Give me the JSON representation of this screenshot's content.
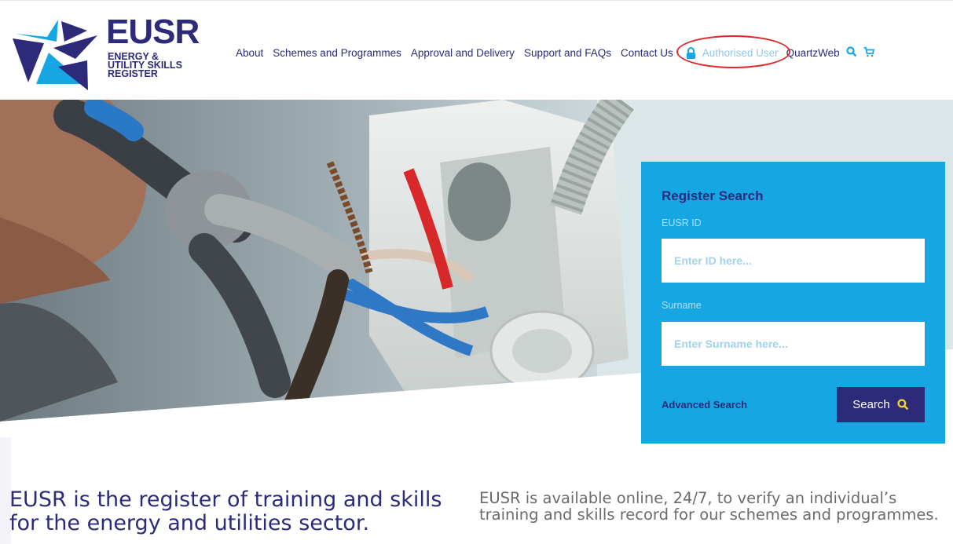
{
  "logo": {
    "word": "EUSR",
    "line1": "ENERGY &",
    "line2": "UTILITY SKILLS",
    "line3": "REGISTER"
  },
  "nav": {
    "items": [
      "About",
      "Schemes and Programmes",
      "Approval and Delivery",
      "Support and FAQs",
      "Contact Us"
    ],
    "authorised": "Authorised User",
    "quartzweb": "QuartzWeb"
  },
  "icons": {
    "lock": "lock-icon",
    "search": "search-icon",
    "cart": "cart-icon"
  },
  "search_panel": {
    "title": "Register Search",
    "id_label": "EUSR ID",
    "id_placeholder": "Enter ID here...",
    "surname_label": "Surname",
    "surname_placeholder": "Enter Surname here...",
    "advanced": "Advanced Search",
    "button": "Search"
  },
  "content": {
    "tagline": "EUSR is the register of training and skills for the energy and utilities sector.",
    "intro": "EUSR is available online, 24/7, to verify an individual’s training and skills record for our schemes and programmes."
  },
  "colors": {
    "brand_navy": "#2d2a7a",
    "brand_blue": "#16a6e4",
    "highlight_ring": "#e0262a"
  }
}
